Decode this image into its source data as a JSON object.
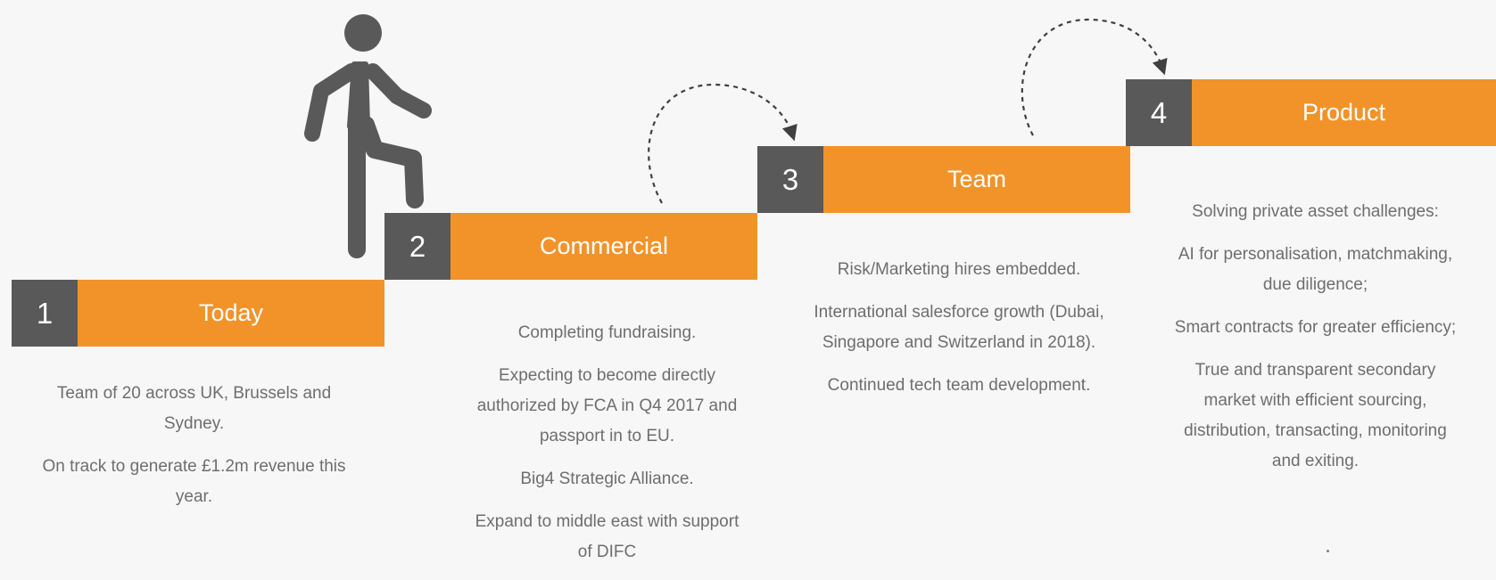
{
  "colors": {
    "accent": "#f2932a",
    "step_number_bg": "#595959",
    "text": "#6e6e6e",
    "background": "#f7f7f7"
  },
  "icons": {
    "figure": "person-climbing-stairs-icon",
    "arrow": "dashed-curved-arrow-icon"
  },
  "steps": [
    {
      "number": "1",
      "label": "Today",
      "description": [
        "Team of 20 across UK, Brussels and Sydney.",
        "On track to generate £1.2m revenue this year."
      ]
    },
    {
      "number": "2",
      "label": "Commercial",
      "description": [
        "Completing fundraising.",
        "Expecting to become directly authorized by FCA in Q4 2017 and passport in to EU.",
        "Big4 Strategic Alliance.",
        "Expand to middle east with support of DIFC"
      ]
    },
    {
      "number": "3",
      "label": "Team",
      "description": [
        "Risk/Marketing hires embedded.",
        "International salesforce growth (Dubai, Singapore and Switzerland in 2018).",
        "Continued tech team development."
      ]
    },
    {
      "number": "4",
      "label": "Product",
      "description": [
        "Solving private asset challenges:",
        "AI for personalisation, matchmaking, due diligence;",
        "Smart contracts for greater efficiency;",
        "True and transparent secondary market with efficient sourcing, distribution, transacting, monitoring and exiting."
      ]
    }
  ]
}
